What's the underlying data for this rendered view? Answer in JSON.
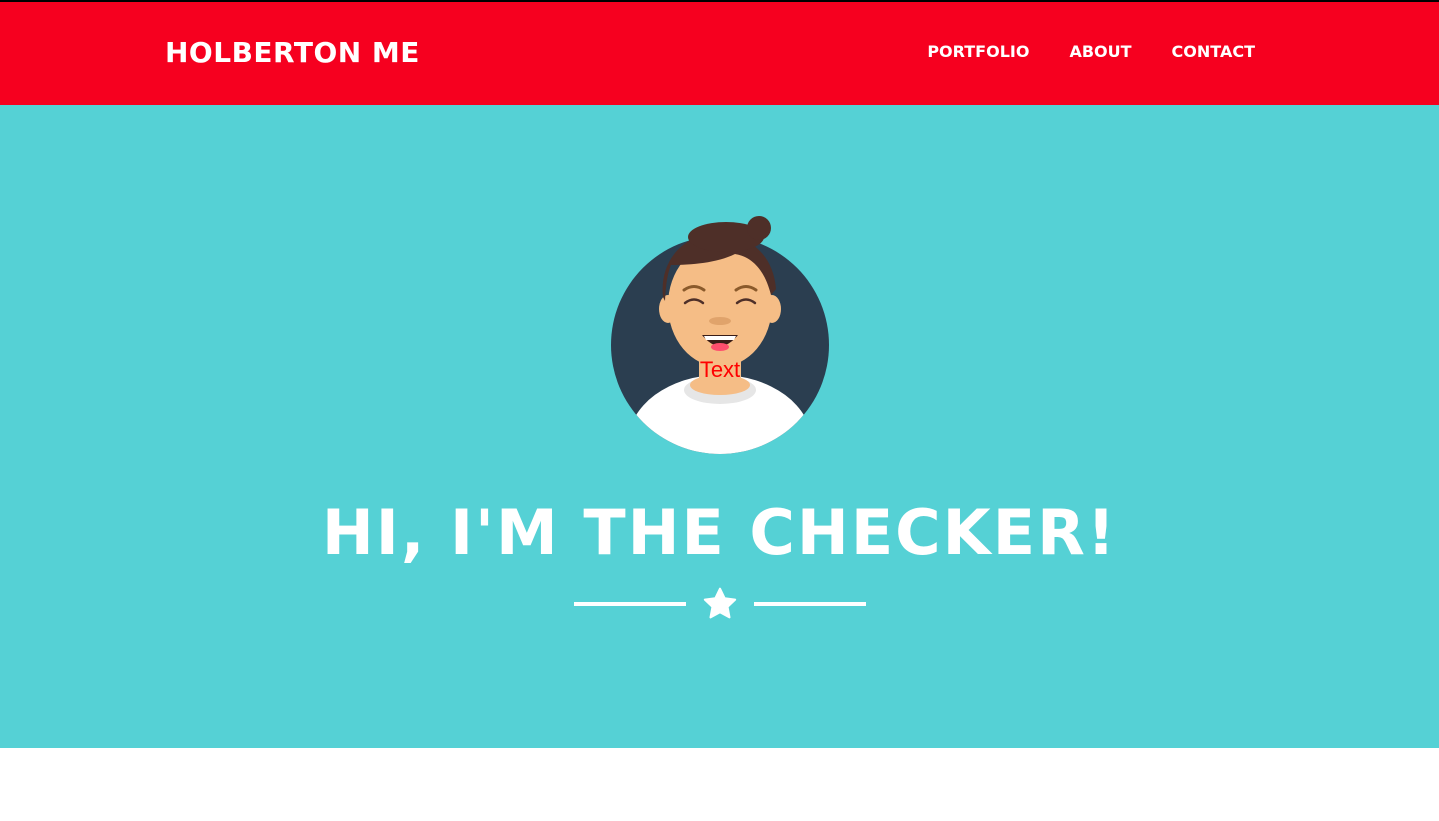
{
  "nav": {
    "brand": "HOLBERTON ME",
    "links": [
      {
        "label": "PORTFOLIO"
      },
      {
        "label": "ABOUT"
      },
      {
        "label": "CONTACT"
      }
    ]
  },
  "hero": {
    "avatar_icon": "smiling-man-avatar-icon",
    "avatar_caption": "Text",
    "title": "HI, I'M THE CHECKER!",
    "divider_icon": "star-icon"
  },
  "colors": {
    "navbar": "#f6001f",
    "hero_background": "#55d1d5",
    "text": "#ffffff",
    "avatar_circle": "#2b3e50",
    "caption": "#ff0000"
  }
}
